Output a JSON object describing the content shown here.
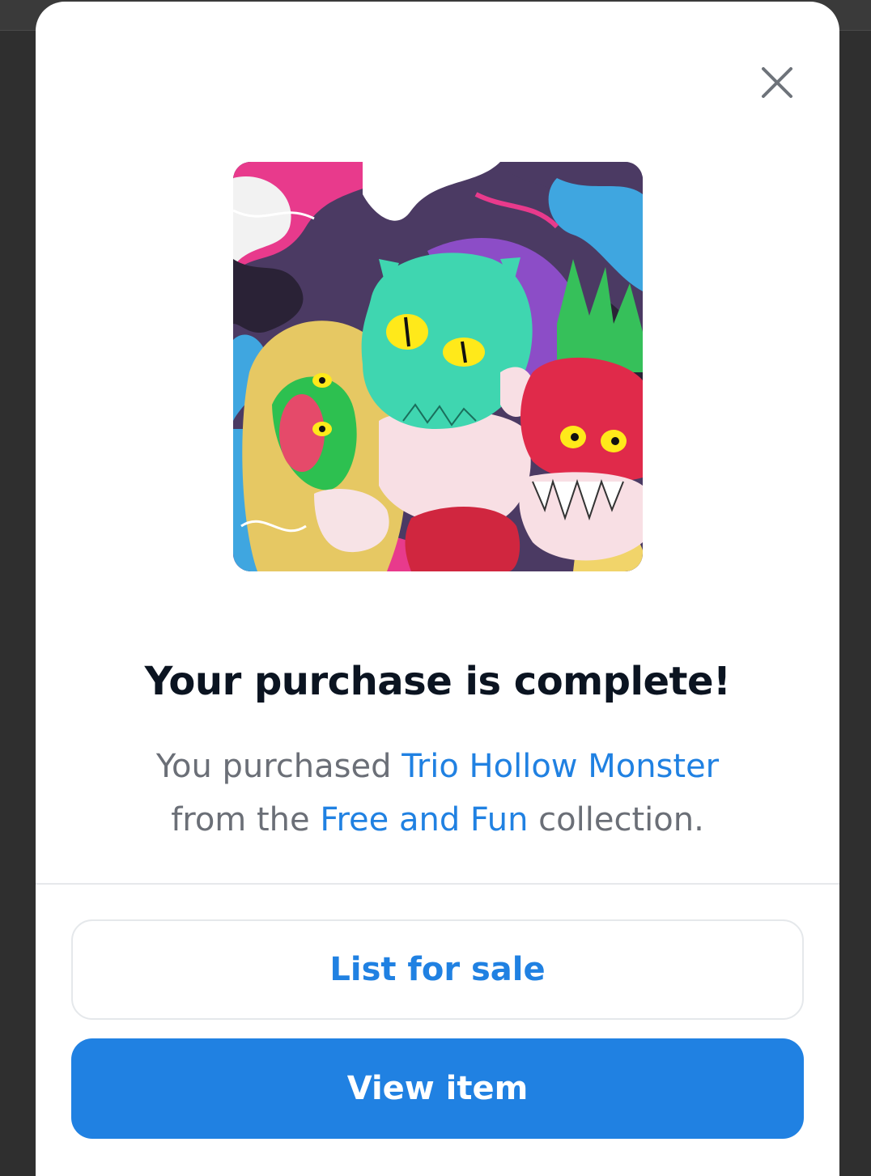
{
  "modal": {
    "close_label": "close",
    "image_alt": "Trio Hollow Monster",
    "title": "Your purchase is complete!",
    "description": {
      "prefix": "You purchased ",
      "item_name": "Trio Hollow Monster",
      "middle": "from the ",
      "collection_name": "Free and Fun",
      "suffix": " collection."
    },
    "buttons": {
      "secondary": "List for sale",
      "primary": "View item"
    }
  },
  "colors": {
    "accent": "#2081e2",
    "title": "#0b1421",
    "body_text": "#6b6f77",
    "backdrop": "#2f2f2f"
  },
  "icons": {
    "close": "close-icon"
  }
}
